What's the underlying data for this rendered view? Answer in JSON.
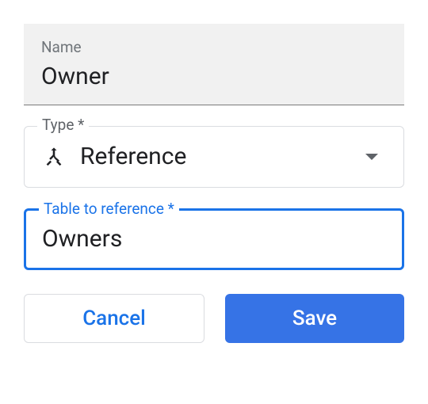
{
  "name_field": {
    "label": "Name",
    "value": "Owner"
  },
  "type_field": {
    "label": "Type *",
    "value": "Reference",
    "icon": "merge-icon"
  },
  "reference_field": {
    "label": "Table to reference *",
    "value": "Owners"
  },
  "buttons": {
    "cancel": "Cancel",
    "save": "Save"
  }
}
